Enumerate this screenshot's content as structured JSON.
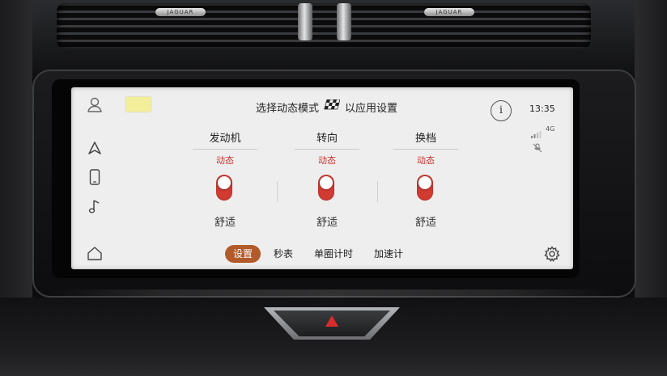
{
  "hardware": {
    "vent_badges": [
      "JAGUAR",
      "JAGUAR"
    ]
  },
  "header": {
    "title_before_icon": "选择动态模式",
    "title_after_icon": "以应用设置",
    "flag_icon": "checkered-flag-icon",
    "info_label": "i"
  },
  "status": {
    "time": "13:35",
    "network": "4G"
  },
  "sidebar": {
    "items": [
      {
        "icon": "user-profile-icon"
      },
      {
        "icon": "navigation-arrow-icon"
      },
      {
        "icon": "phone-icon"
      },
      {
        "icon": "music-note-icon"
      },
      {
        "icon": "home-icon"
      }
    ]
  },
  "columns": [
    {
      "title": "发动机",
      "top_label": "动态",
      "bottom_label": "舒适",
      "state": "动态"
    },
    {
      "title": "转向",
      "top_label": "动态",
      "bottom_label": "舒适",
      "state": "动态"
    },
    {
      "title": "换档",
      "top_label": "动态",
      "bottom_label": "舒适",
      "state": "动态"
    }
  ],
  "tabs": [
    {
      "label": "设置",
      "active": true
    },
    {
      "label": "秒表",
      "active": false
    },
    {
      "label": "单圈计时",
      "active": false
    },
    {
      "label": "加速计",
      "active": false
    }
  ],
  "colors": {
    "accent": "#d23b32",
    "active_tab": "#b35a2a"
  }
}
